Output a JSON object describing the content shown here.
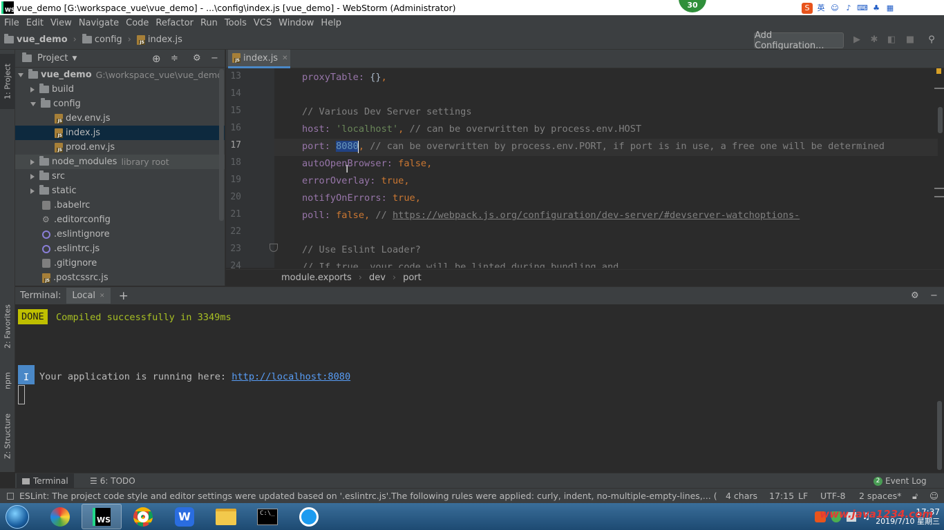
{
  "window": {
    "title": "vue_demo [G:\\workspace_vue\\vue_demo] - ...\\config\\index.js [vue_demo] - WebStorm (Administrator)",
    "logo": "WS",
    "badge": "30",
    "ime_label": "英"
  },
  "menu": [
    "File",
    "Edit",
    "View",
    "Navigate",
    "Code",
    "Refactor",
    "Run",
    "Tools",
    "VCS",
    "Window",
    "Help"
  ],
  "nav": {
    "crumbs": [
      "vue_demo",
      "config",
      "index.js"
    ],
    "add_configuration": "Add Configuration..."
  },
  "left_strip": {
    "project_tab": "1: Project",
    "favorites_tab": "2: Favorites",
    "npm_tab": "npm",
    "structure_tab": "Z: Structure"
  },
  "project": {
    "header": "Project",
    "root_name": "vue_demo",
    "root_path": "G:\\workspace_vue\\vue_demo",
    "items": [
      {
        "label": "build"
      },
      {
        "label": "config"
      },
      {
        "label": "dev.env.js"
      },
      {
        "label": "index.js"
      },
      {
        "label": "prod.env.js"
      },
      {
        "label": "node_modules",
        "note": "library root"
      },
      {
        "label": "src"
      },
      {
        "label": "static"
      },
      {
        "label": ".babelrc"
      },
      {
        "label": ".editorconfig"
      },
      {
        "label": ".eslintignore"
      },
      {
        "label": ".eslintrc.js"
      },
      {
        "label": ".gitignore"
      },
      {
        "label": ".postcssrc.js"
      }
    ]
  },
  "editor": {
    "tab": "index.js",
    "line_numbers": [
      "13",
      "14",
      "15",
      "16",
      "17",
      "18",
      "19",
      "20",
      "21",
      "22",
      "23",
      "24"
    ],
    "lines": {
      "l13a": "proxyTable: ",
      "l13b": "{}",
      "l13c": ",",
      "l15": "// Various Dev Server settings",
      "l16a": "host: ",
      "l16b": "'localhost'",
      "l16c": ", ",
      "l16d": "// can be overwritten by process.env.HOST",
      "l17a": "port: ",
      "l17b": "8080",
      "l17c": ", ",
      "l17d": "// can be overwritten by process.env.PORT, if port is in use, a free one will be determined",
      "l18a": "autoOpenBrowser: ",
      "l18b": "false",
      "l18c": ",",
      "l19a": "errorOverlay: ",
      "l19b": "true",
      "l19c": ",",
      "l20a": "notifyOnErrors: ",
      "l20b": "true",
      "l20c": ",",
      "l21a": "poll: ",
      "l21b": "false",
      "l21c": ", ",
      "l21d": "// ",
      "l21e": "https://webpack.js.org/configuration/dev-server/#devserver-watchoptions-",
      "l23": "// Use Eslint Loader?",
      "l24": "// If true, your code will be linted during bundling and"
    },
    "breadcrumb": [
      "module.exports",
      "dev",
      "port"
    ]
  },
  "terminal": {
    "label": "Terminal:",
    "tab": "Local",
    "done_badge": "DONE",
    "compiled_msg": "Compiled successfully in 3349ms",
    "info_badge": "I",
    "running_msg": "Your application is running here: ",
    "url": "http://localhost:8080"
  },
  "bottom_tabs": {
    "terminal": "Terminal",
    "todo": "6: TODO",
    "event_log_count": "2",
    "event_log": "Event Log"
  },
  "status": {
    "message": "ESLint: The project code style and editor settings were updated based on '.eslintrc.js'.The following rules were applied: curly, indent, no-multiple-empty-lines,... (a minute ago)",
    "chars": "4 chars",
    "position": "17:15",
    "line_sep": "LF",
    "encoding": "UTF-8",
    "indent": "2 spaces*"
  },
  "taskbar": {
    "time": "17:37",
    "date": "2019/7/10 星期三",
    "watermark": "www.java1234.com"
  },
  "colors": {
    "accent": "#4a88c7",
    "keyword": "#cc7832",
    "string": "#6a8759",
    "comment": "#808080",
    "number": "#6897bb",
    "done": "#bfbf00",
    "success": "#a8c023"
  }
}
